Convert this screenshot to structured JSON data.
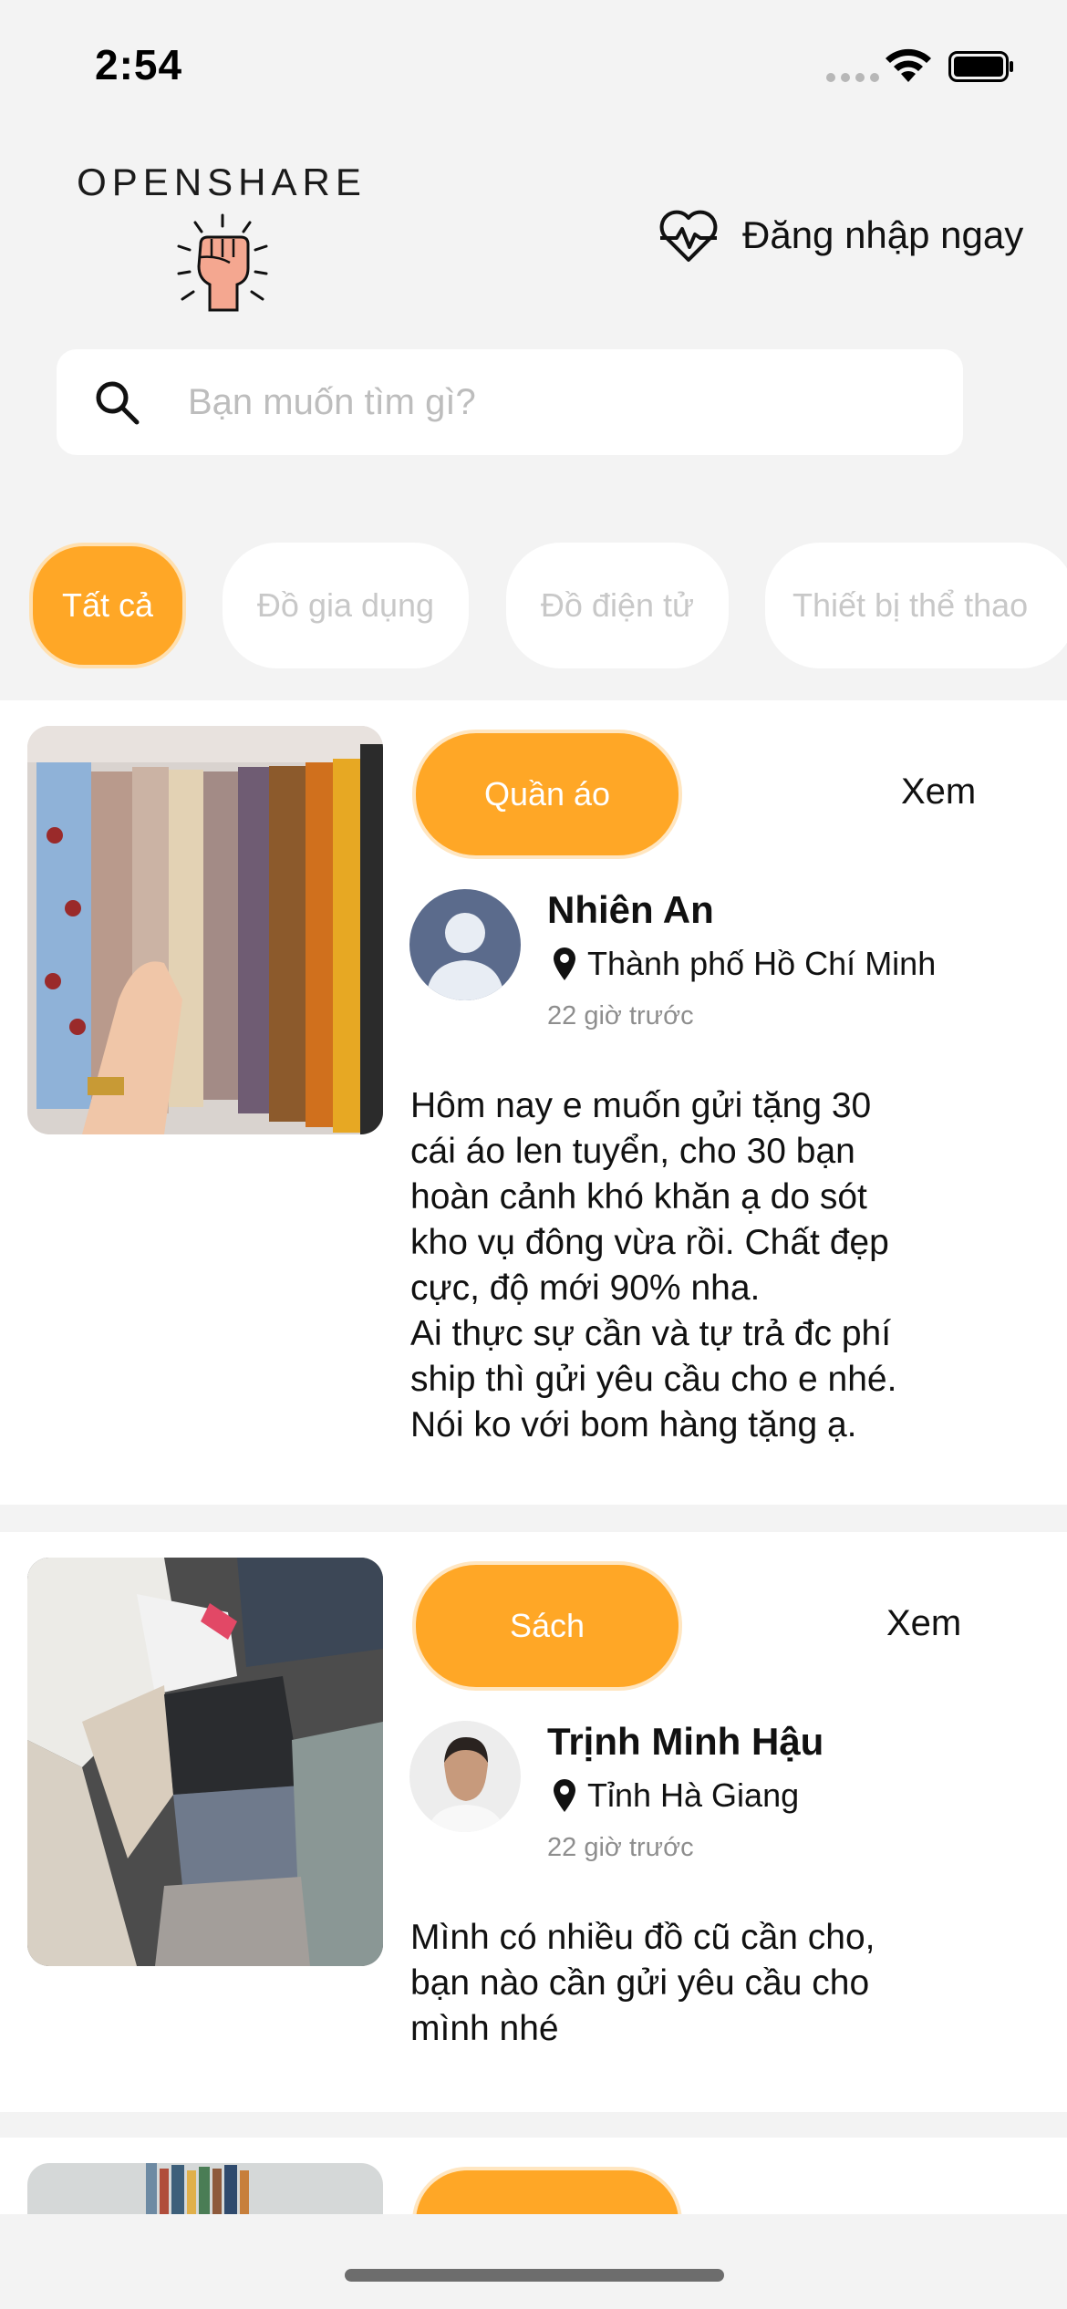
{
  "status_bar": {
    "time": "2:54"
  },
  "header": {
    "logo_text": "OPENSHARE",
    "login_label": "Đăng nhập ngay"
  },
  "search": {
    "placeholder": "Bạn muốn tìm gì?"
  },
  "categories": [
    {
      "label": "Tất cả",
      "active": true
    },
    {
      "label": "Đồ gia dụng",
      "active": false
    },
    {
      "label": "Đồ điện tử",
      "active": false
    },
    {
      "label": "Thiết bị thể thao",
      "active": false
    }
  ],
  "posts": [
    {
      "category": "Quần áo",
      "view_label": "Xem",
      "author": "Nhiên An",
      "location": "Thành phố Hồ Chí Minh",
      "time": "22 giờ trước",
      "text": "Hôm nay e muốn gửi tặng 30\ncái áo len tuyển, cho 30 bạn\nhoàn cảnh khó khăn ạ do sót\nkho vụ đông vừa rồi. Chất đẹp\ncực, độ mới 90% nha.\nAi thực sự cần và tự trả đc phí\nship thì gửi yêu cầu cho e nhé.\nNói ko với bom hàng tặng ạ."
    },
    {
      "category": "Sách",
      "view_label": "Xem",
      "author": "Trịnh Minh Hậu",
      "location": "Tỉnh Hà Giang",
      "time": "22 giờ trước",
      "text": "Mình có nhiều đồ cũ cần cho,\nbạn nào cần gửi yêu cầu cho\nmình nhé"
    }
  ],
  "colors": {
    "accent": "#ffa726",
    "background": "#f3f3f3",
    "muted_text": "#8e8e8e"
  }
}
